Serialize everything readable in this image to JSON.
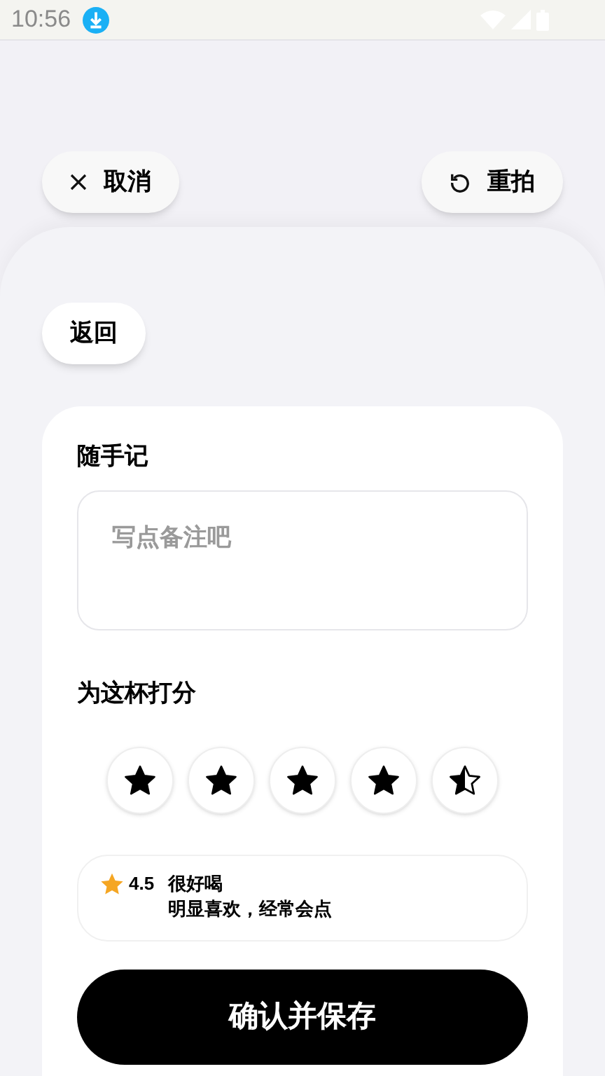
{
  "status_bar": {
    "time": "10:56"
  },
  "top_actions": {
    "cancel": "取消",
    "retake": "重拍"
  },
  "back_button": "返回",
  "note": {
    "title": "随手记",
    "placeholder": "写点备注吧"
  },
  "rating": {
    "title": "为这杯打分",
    "stars": 4.5
  },
  "summary": {
    "score": "4.5",
    "label": "很好喝",
    "description": "明显喜欢，经常会点"
  },
  "confirm_button": "确认并保存"
}
